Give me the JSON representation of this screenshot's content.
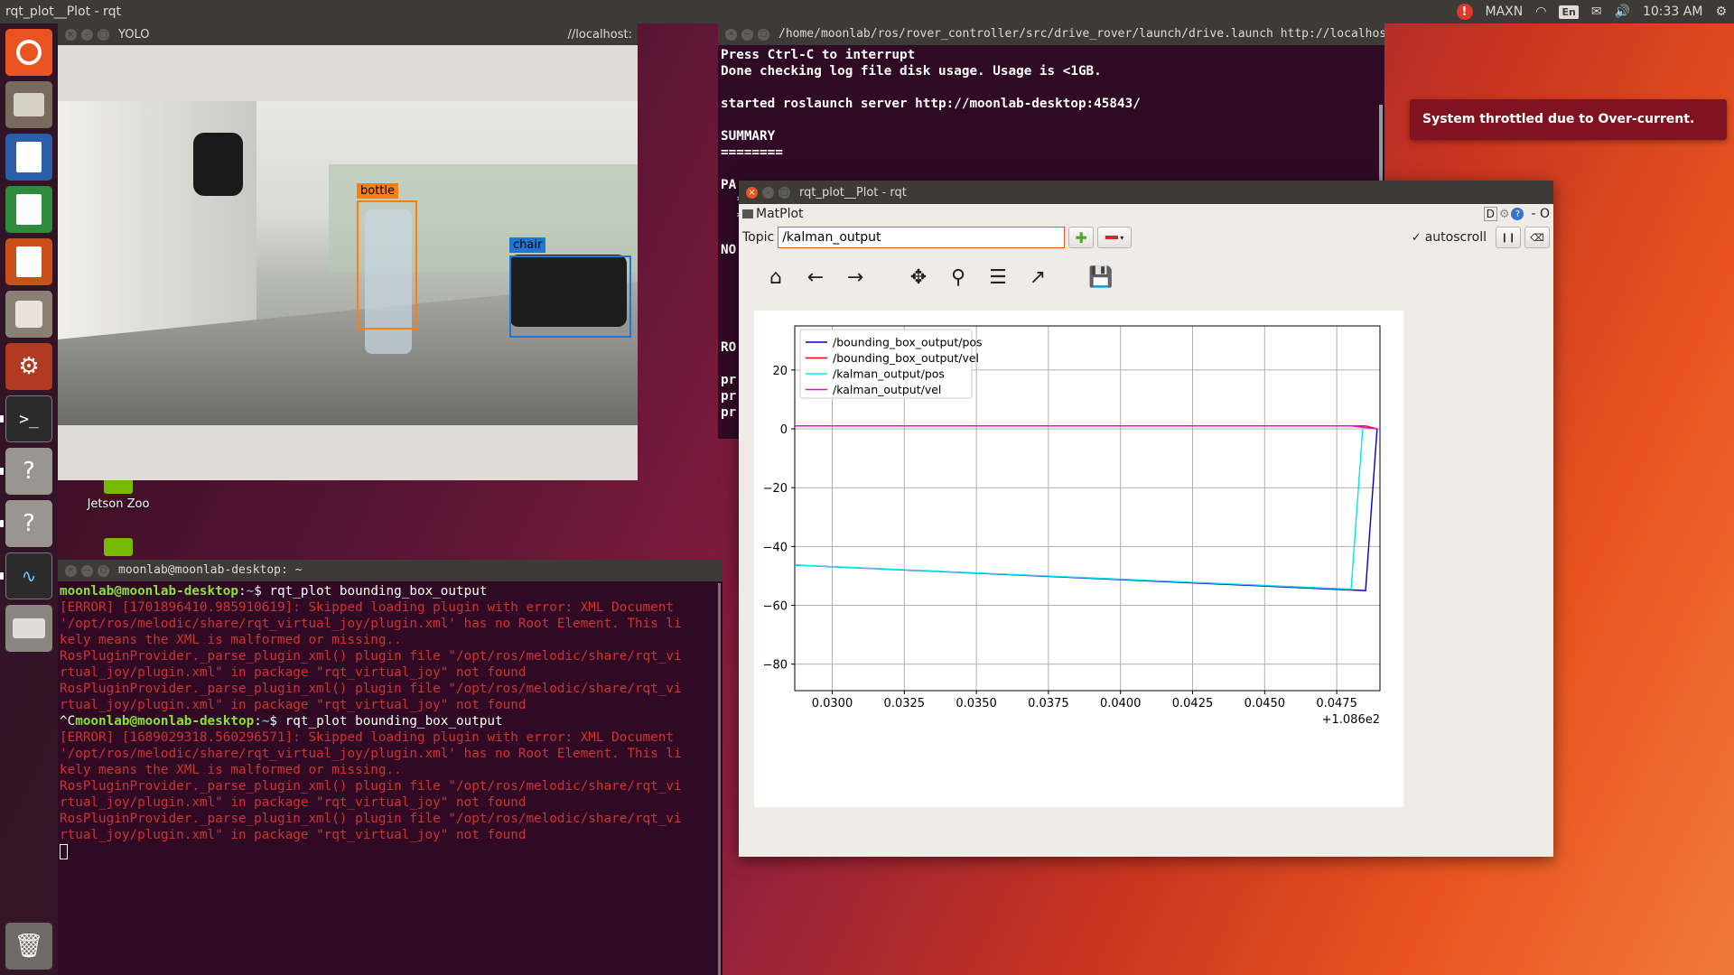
{
  "topbar": {
    "title": "rqt_plot__Plot - rqt",
    "power_mode": "MAXN",
    "lang": "En",
    "time": "10:33 AM"
  },
  "desktop": {
    "icons": [
      {
        "label": "Jetson Zoo"
      }
    ]
  },
  "notification": {
    "text": "System throttled due to Over-current."
  },
  "yolo_window": {
    "title": "YOLO",
    "right_title": "//localhost:",
    "detections": [
      {
        "label": "bottle",
        "color": "#ff7f0e"
      },
      {
        "label": "chair",
        "color": "#1f77d4"
      }
    ]
  },
  "launch_terminal": {
    "title": "/home/moonlab/ros/rover_controller/src/drive_rover/launch/drive.launch http://localhost:1",
    "lines": [
      "Press Ctrl-C to interrupt",
      "Done checking log file disk usage. Usage is <1GB.",
      "",
      "started roslaunch server http://moonlab-desktop:45843/",
      "",
      "SUMMARY",
      "========",
      "",
      "PA",
      "  *",
      "  *",
      "",
      "NO",
      "",
      "",
      "",
      "",
      "",
      "RO",
      "",
      "pr",
      "pr",
      "pr"
    ]
  },
  "bottom_terminal": {
    "title": "moonlab@moonlab-desktop: ~",
    "prompt_user": "moonlab@moonlab-desktop",
    "prompt_path": "~",
    "prompt_sym": "$",
    "cmd1": " rqt_plot bounding_box_output",
    "block1": [
      "[ERROR] [1701896410.985910619]: Skipped loading plugin with error: XML Document",
      "'/opt/ros/melodic/share/rqt_virtual_joy/plugin.xml' has no Root Element. This li",
      "kely means the XML is malformed or missing..",
      "RosPluginProvider._parse_plugin_xml() plugin file \"/opt/ros/melodic/share/rqt_vi",
      "rtual_joy/plugin.xml\" in package \"rqt_virtual_joy\" not found",
      "RosPluginProvider._parse_plugin_xml() plugin file \"/opt/ros/melodic/share/rqt_vi",
      "rtual_joy/plugin.xml\" in package \"rqt_virtual_joy\" not found"
    ],
    "ctrl_c": "^C",
    "cmd2": " rqt_plot bounding_box_output",
    "block2": [
      "[ERROR] [1689029318.560296571]: Skipped loading plugin with error: XML Document",
      "'/opt/ros/melodic/share/rqt_virtual_joy/plugin.xml' has no Root Element. This li",
      "kely means the XML is malformed or missing..",
      "RosPluginProvider._parse_plugin_xml() plugin file \"/opt/ros/melodic/share/rqt_vi",
      "rtual_joy/plugin.xml\" in package \"rqt_virtual_joy\" not found",
      "RosPluginProvider._parse_plugin_xml() plugin file \"/opt/ros/melodic/share/rqt_vi",
      "rtual_joy/plugin.xml\" in package \"rqt_virtual_joy\" not found"
    ]
  },
  "rqt": {
    "title": "rqt_plot__Plot - rqt",
    "plugin_name": "MatPlot",
    "topic_label": "Topic",
    "topic_value": "/kalman_output",
    "autoscroll_label": "autoscroll",
    "autoscroll_checked": true,
    "header_right": "D",
    "header_dash": "- O"
  },
  "chart_data": {
    "type": "line",
    "xlim": [
      0.0287,
      0.049
    ],
    "ylim": [
      -89,
      35
    ],
    "x_ticks": [
      0.03,
      0.0325,
      0.035,
      0.0375,
      0.04,
      0.0425,
      0.045,
      0.0475
    ],
    "x_tick_labels": [
      "0.0300",
      "0.0325",
      "0.0350",
      "0.0375",
      "0.0400",
      "0.0425",
      "0.0450",
      "0.0475"
    ],
    "y_ticks": [
      20,
      0,
      -20,
      -40,
      -60,
      -80
    ],
    "y_tick_labels": [
      "20",
      "0",
      "−20",
      "−40",
      "−60",
      "−80"
    ],
    "x_offset_label": "+1.086e2",
    "grid": true,
    "legend_position": "upper-left",
    "series": [
      {
        "name": "/bounding_box_output/pos",
        "color": "#0000cc",
        "x": [
          0.0287,
          0.0485,
          0.0489
        ],
        "y": [
          -46.3,
          -55,
          0
        ]
      },
      {
        "name": "/bounding_box_output/vel",
        "color": "#ff0000",
        "x": [
          0.0287,
          0.0485,
          0.0489
        ],
        "y": [
          1,
          1,
          0
        ]
      },
      {
        "name": "/kalman_output/pos",
        "color": "#00e5ee",
        "x": [
          0.0287,
          0.048,
          0.0484
        ],
        "y": [
          -46.3,
          -54.5,
          0
        ]
      },
      {
        "name": "/kalman_output/vel",
        "color": "#ee00ee",
        "x": [
          0.0287,
          0.048,
          0.0489
        ],
        "y": [
          1,
          1,
          0
        ]
      }
    ]
  }
}
